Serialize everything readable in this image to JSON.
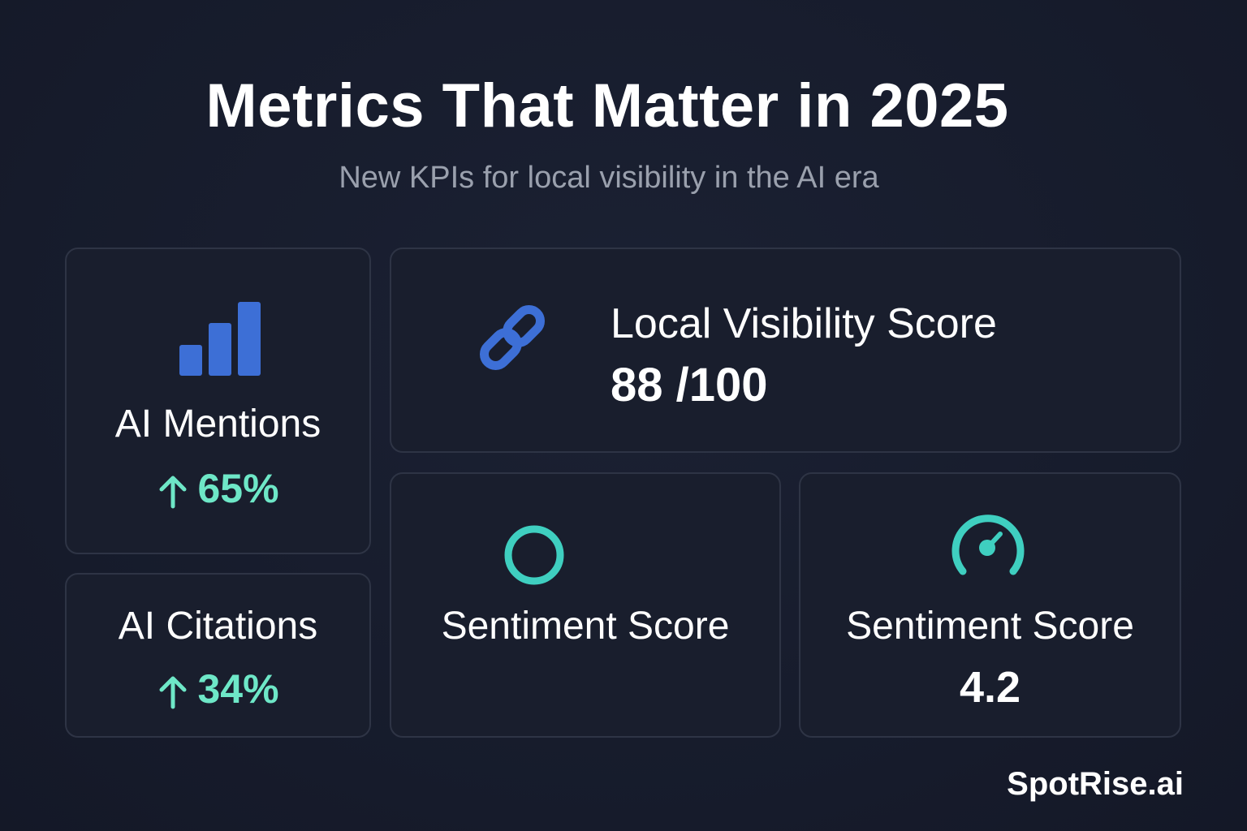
{
  "header": {
    "title": "Metrics That Matter in 2025",
    "subtitle": "New KPIs for local visibility in the AI era"
  },
  "cards": {
    "ai_mentions": {
      "icon": "bar-chart-icon",
      "label": "AI Mentions",
      "trend": "65%",
      "trend_direction": "up"
    },
    "ai_citations": {
      "label": "AI Citations",
      "trend": "34%",
      "trend_direction": "up"
    },
    "local_visibility": {
      "icon": "link-icon",
      "label": "Local Visibility Score",
      "value": "88 /100"
    },
    "sentiment_a": {
      "icon": "circle-icon",
      "label": "Sentiment Score"
    },
    "sentiment_b": {
      "icon": "gauge-icon",
      "label": "Sentiment Score",
      "value": "4.2"
    }
  },
  "footer": {
    "brand": "SpotRise.ai"
  },
  "colors": {
    "background": "#161b2b",
    "card_background": "#191e2d",
    "card_border": "#2e3445",
    "accent_blue": "#3d6fd6",
    "accent_teal": "#3fcfc0",
    "trend_green": "#6ee7c7",
    "subtitle_gray": "#9aa0ad"
  }
}
